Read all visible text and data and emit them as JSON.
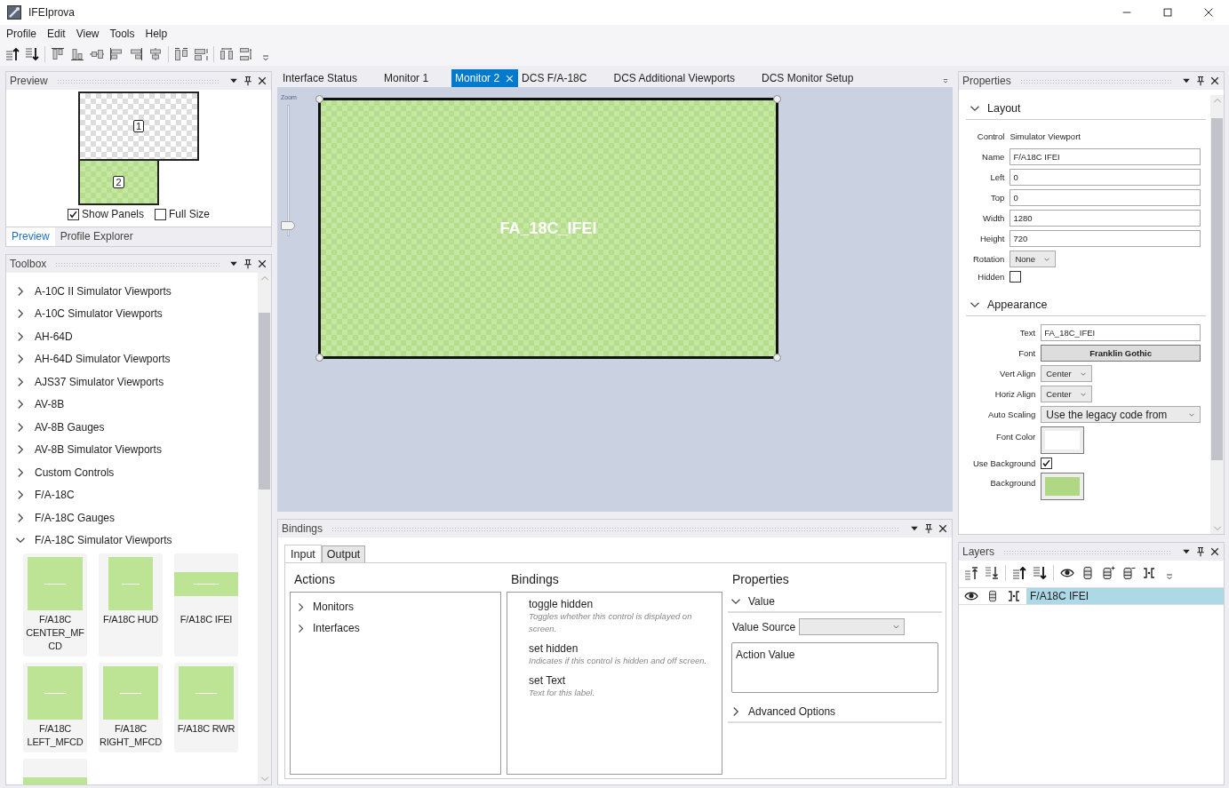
{
  "window": {
    "title": "IFEIprova"
  },
  "menu": [
    "Profile",
    "Edit",
    "View",
    "Tools",
    "Help"
  ],
  "preview_panel": {
    "title": "Preview",
    "monitors": [
      {
        "label": "1",
        "selected": false
      },
      {
        "label": "2",
        "selected": true
      }
    ],
    "options": [
      {
        "label": "Show Panels",
        "checked": true
      },
      {
        "label": "Full Size",
        "checked": false
      }
    ],
    "tabs": [
      {
        "label": "Preview",
        "selected": true
      },
      {
        "label": "Profile Explorer",
        "selected": false
      }
    ]
  },
  "toolbox": {
    "title": "Toolbox",
    "groups": [
      {
        "label": "A-10C II Simulator Viewports",
        "expanded": false
      },
      {
        "label": "A-10C Simulator Viewports",
        "expanded": false
      },
      {
        "label": "AH-64D",
        "expanded": false
      },
      {
        "label": "AH-64D Simulator Viewports",
        "expanded": false
      },
      {
        "label": "AJS37 Simulator Viewports",
        "expanded": false
      },
      {
        "label": "AV-8B",
        "expanded": false
      },
      {
        "label": "AV-8B Gauges",
        "expanded": false
      },
      {
        "label": "AV-8B Simulator Viewports",
        "expanded": false
      },
      {
        "label": "Custom Controls",
        "expanded": false
      },
      {
        "label": "F/A-18C",
        "expanded": false
      },
      {
        "label": "F/A-18C Gauges",
        "expanded": false
      },
      {
        "label": "F/A-18C Simulator Viewports",
        "expanded": true
      }
    ],
    "items": [
      {
        "label": "F/A18C CENTER_MFCD",
        "kind": "square"
      },
      {
        "label": "F/A18C HUD",
        "kind": "portrait"
      },
      {
        "label": "F/A18C IFEI",
        "kind": "wide"
      },
      {
        "label": "F/A18C LEFT_MFCD",
        "kind": "square"
      },
      {
        "label": "F/A18C RIGHT_MFCD",
        "kind": "square"
      },
      {
        "label": "F/A18C RWR",
        "kind": "square"
      },
      {
        "kind": "wide"
      }
    ]
  },
  "document": {
    "tabs": [
      {
        "label": "Interface Status",
        "selected": false
      },
      {
        "label": "Monitor 1",
        "selected": false
      },
      {
        "label": "Monitor 2",
        "selected": true
      },
      {
        "label": "DCS F/A-18C",
        "selected": false
      },
      {
        "label": "DCS Additional Viewports",
        "selected": false
      },
      {
        "label": "DCS Monitor Setup",
        "selected": false
      }
    ],
    "zoom": {
      "label": "Zoom",
      "level": 0.08
    },
    "viewport": {
      "text": "FA_18C_IFEI",
      "selected": true
    }
  },
  "bindings": {
    "title": "Bindings",
    "tabs": [
      {
        "label": "Input",
        "selected": true
      },
      {
        "label": "Output",
        "selected": false
      }
    ],
    "actions": {
      "heading": "Actions",
      "items": [
        {
          "label": "Monitors",
          "expanded": false
        },
        {
          "label": "Interfaces",
          "expanded": false
        }
      ]
    },
    "bindings_list": {
      "heading": "Bindings",
      "items": [
        {
          "name": "toggle hidden",
          "description": "Toggles whether this control is displayed on screen."
        },
        {
          "name": "set hidden",
          "description": "Indicates if this control is hidden and off screen."
        },
        {
          "name": "set Text",
          "description": "Text for this label."
        }
      ]
    },
    "properties": {
      "heading": "Properties",
      "value_section": {
        "label": "Value",
        "expanded": true
      },
      "value_source": {
        "label": "Value Source"
      },
      "action_value": {
        "label": "Action Value"
      },
      "advanced": {
        "label": "Advanced Options",
        "expanded": false
      }
    }
  },
  "properties": {
    "title": "Properties",
    "sections": [
      {
        "label": "Layout",
        "expanded": true,
        "rows": [
          {
            "kind": "text",
            "label": "Control",
            "value": "Simulator Viewport"
          },
          {
            "kind": "field",
            "label": "Name",
            "value": "F/A18C IFEI"
          },
          {
            "kind": "field",
            "label": "Left",
            "value": "0"
          },
          {
            "kind": "field",
            "label": "Top",
            "value": "0"
          },
          {
            "kind": "field",
            "label": "Width",
            "value": "1280"
          },
          {
            "kind": "field",
            "label": "Height",
            "value": "720"
          },
          {
            "kind": "dropdown",
            "label": "Rotation",
            "value": "None"
          },
          {
            "kind": "checkbox",
            "label": "Hidden",
            "checked": false
          }
        ]
      },
      {
        "label": "Appearance",
        "expanded": true,
        "rows": [
          {
            "kind": "field",
            "label": "Text",
            "value": "FA_18C_IFEI"
          },
          {
            "kind": "button",
            "label": "Font",
            "value": "Franklin Gothic"
          },
          {
            "kind": "dropdown",
            "label": "Vert Align",
            "value": "Center"
          },
          {
            "kind": "dropdown",
            "label": "Horiz Align",
            "value": "Center"
          },
          {
            "kind": "combo",
            "label": "Auto Scaling",
            "value": "Use the legacy code from"
          },
          {
            "kind": "color",
            "label": "Font Color",
            "color": "#ffffff"
          },
          {
            "kind": "checkbox",
            "label": "Use Background",
            "checked": true
          },
          {
            "kind": "color",
            "label": "Background",
            "color": "#b0d884"
          }
        ]
      }
    ]
  },
  "layers": {
    "title": "Layers",
    "items": [
      {
        "label": "F/A18C IFEI",
        "selected": true
      }
    ]
  }
}
